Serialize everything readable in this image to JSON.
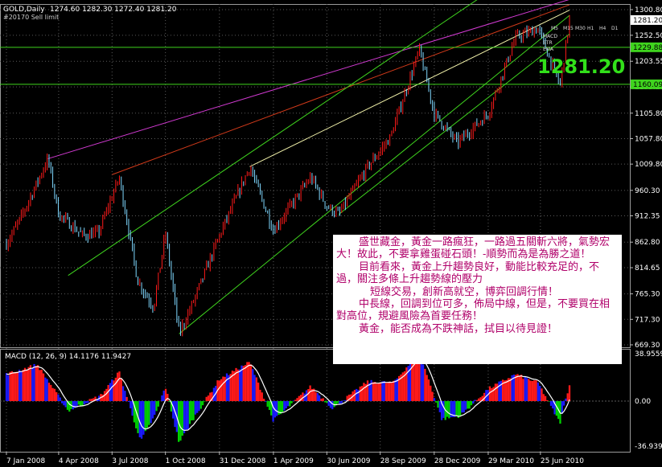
{
  "header": {
    "symbol": "GOLD,Daily",
    "ohlc": "1274.60 1282.30 1272.40 1281.20",
    "subtitle": "#20170 Sell limit"
  },
  "price_panel": {
    "y_ticks": [
      "1300.80",
      "1252.50",
      "1203.55",
      "1155.20",
      "1105.80",
      "1057.80",
      "1009.80",
      "960.30",
      "912.35",
      "862.80",
      "814.65",
      "765.30",
      "717.30",
      "669.30"
    ],
    "current_price_tag": "1281.20",
    "level_tags": [
      "1229.88",
      "1160.09"
    ],
    "big_price": "1281.20",
    "ma_legend": [
      "M5",
      "M15",
      "M30",
      "H1",
      "H4",
      "D1"
    ],
    "indicator_legend": [
      "MACD",
      "STR",
      "EMA"
    ]
  },
  "macd_panel": {
    "label": "MACD (12, 26, 9)",
    "values": "14.1176 11.9427",
    "y_ticks": [
      "38.9559",
      "0.00",
      "-36.9396"
    ]
  },
  "x_ticks": [
    "7 Jan 2008",
    "4 Apr 2008",
    "3 Jul 2008",
    "1 Oct 2008",
    "31 Dec 2008",
    "1 Apr 2009",
    "30 Jun 2009",
    "28 Sep 2009",
    "28 Dec 2009",
    "29 Mar 2010",
    "25 Jun 2010"
  ],
  "annotation": [
    "盛世藏金，黃金一路瘋狂，一路過五關斬六將，氣勢宏大！故此，不要拿雞蛋碰石頭！-順勢而為是為勝之道！",
    "目前看來，黃金上升趨勢良好，動能比較充足的，不過，關注多條上升趨勢線的壓力",
    "短線交易，創新高就空，博弈回調行情！",
    "中長線，回調到位可多，佈局中線，但是，不要買在相對高位，規避風險為首要任務！",
    "黃金，能否成為不跌神話，拭目以待見證！"
  ],
  "colors": {
    "bull_candle": "#ff1a1a",
    "bear_candle": "#7fd8ff",
    "grid": "#5a5a5a",
    "trend_green": "#3fd41e",
    "trend_magenta": "#d23ad2",
    "trend_red": "#d23a1a",
    "trend_yellow": "#f2f2aa",
    "level_line": "#3fd41e",
    "big_price": "#32e01a",
    "macd_pos": "#ff1a1a",
    "macd_neg_weak": "#00d000",
    "macd_neg_strong": "#1a1aff",
    "macd_signal": "#ffffff",
    "note_text": "#b0006a"
  },
  "chart_data": {
    "type": "candlestick",
    "title": "GOLD,Daily",
    "x_range": [
      "2008-01-07",
      "2010-08-13"
    ],
    "ylim": [
      669.3,
      1300.8
    ],
    "grid": true,
    "last": {
      "open": 1274.6,
      "high": 1282.3,
      "low": 1272.4,
      "close": 1281.2
    },
    "price_path": [
      [
        "2008-01-07",
        860
      ],
      [
        "2008-02-01",
        910
      ],
      [
        "2008-03-17",
        1020
      ],
      [
        "2008-04-04",
        915
      ],
      [
        "2008-05-15",
        875
      ],
      [
        "2008-06-10",
        880
      ],
      [
        "2008-07-15",
        985
      ],
      [
        "2008-08-15",
        790
      ],
      [
        "2008-09-11",
        740
      ],
      [
        "2008-10-01",
        880
      ],
      [
        "2008-10-24",
        690
      ],
      [
        "2008-11-15",
        745
      ],
      [
        "2008-12-31",
        875
      ],
      [
        "2009-02-20",
        1005
      ],
      [
        "2009-04-01",
        885
      ],
      [
        "2009-06-03",
        985
      ],
      [
        "2009-06-30",
        930
      ],
      [
        "2009-07-20",
        915
      ],
      [
        "2009-09-07",
        1005
      ],
      [
        "2009-10-15",
        1060
      ],
      [
        "2009-12-03",
        1225
      ],
      [
        "2009-12-28",
        1105
      ],
      [
        "2010-02-05",
        1050
      ],
      [
        "2010-03-29",
        1105
      ],
      [
        "2010-05-14",
        1248
      ],
      [
        "2010-06-21",
        1265
      ],
      [
        "2010-07-28",
        1158
      ],
      [
        "2010-08-13",
        1281.2
      ]
    ],
    "horizontal_levels": [
      1229.88,
      1160.09
    ],
    "macd": {
      "params": [
        12,
        26,
        9
      ],
      "main": 14.1176,
      "signal": 11.9427,
      "ylim": [
        -36.9396,
        38.9559
      ],
      "path": [
        [
          "2008-01-07",
          22
        ],
        [
          "2008-02-28",
          30
        ],
        [
          "2008-04-20",
          -8
        ],
        [
          "2008-06-15",
          5
        ],
        [
          "2008-07-15",
          24
        ],
        [
          "2008-08-20",
          -33
        ],
        [
          "2008-09-15",
          -10
        ],
        [
          "2008-10-01",
          12
        ],
        [
          "2008-10-24",
          -34
        ],
        [
          "2008-11-20",
          -12
        ],
        [
          "2008-12-31",
          18
        ],
        [
          "2009-02-20",
          32
        ],
        [
          "2009-04-01",
          -16
        ],
        [
          "2009-06-03",
          12
        ],
        [
          "2009-07-10",
          -6
        ],
        [
          "2009-09-07",
          16
        ],
        [
          "2009-10-20",
          15
        ],
        [
          "2009-12-03",
          40
        ],
        [
          "2010-01-10",
          -15
        ],
        [
          "2010-02-10",
          -12
        ],
        [
          "2010-03-29",
          10
        ],
        [
          "2010-05-14",
          22
        ],
        [
          "2010-06-21",
          15
        ],
        [
          "2010-07-28",
          -18
        ],
        [
          "2010-08-13",
          14.1176
        ]
      ]
    }
  }
}
